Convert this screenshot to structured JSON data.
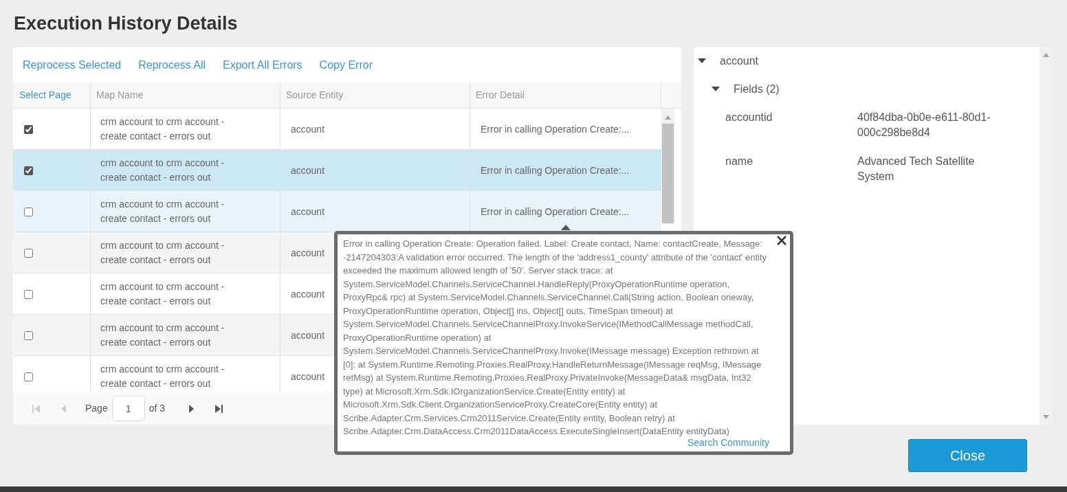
{
  "title": "Execution History Details",
  "toolbar": [
    "Reprocess Selected",
    "Reprocess All",
    "Export All Errors",
    "Copy Error"
  ],
  "table": {
    "select_page": "Select Page",
    "columns": [
      "Map Name",
      "Source Entity",
      "Error Detail"
    ],
    "rows": [
      {
        "checked": true,
        "selected": false,
        "hovered": false,
        "map_name": "crm account to crm account - create contact - errors out",
        "source_entity": "account",
        "error_detail": "Error in calling Operation Create:..."
      },
      {
        "checked": true,
        "selected": true,
        "hovered": false,
        "map_name": "crm account to crm account - create contact - errors out",
        "source_entity": "account",
        "error_detail": "Error in calling Operation Create:..."
      },
      {
        "checked": false,
        "selected": false,
        "hovered": true,
        "map_name": "crm account to crm account - create contact - errors out",
        "source_entity": "account",
        "error_detail": "Error in calling Operation Create:..."
      },
      {
        "checked": false,
        "selected": false,
        "hovered": false,
        "map_name": "crm account to crm account - create contact - errors out",
        "source_entity": "account"
      },
      {
        "checked": false,
        "selected": false,
        "hovered": false,
        "map_name": "crm account to crm account - create contact - errors out",
        "source_entity": "account"
      },
      {
        "checked": false,
        "selected": false,
        "hovered": false,
        "map_name": "crm account to crm account - create contact - errors out",
        "source_entity": "account"
      },
      {
        "checked": false,
        "selected": false,
        "hovered": false,
        "map_name": "crm account to crm account - create contact - errors out",
        "source_entity": "account"
      }
    ]
  },
  "pager": {
    "label": "Page",
    "value": "1",
    "of": "of 3",
    "buttons": [
      {
        "kind": "first",
        "disabled": true
      },
      {
        "kind": "prev",
        "disabled": true
      },
      {
        "kind": "next",
        "disabled": false
      },
      {
        "kind": "last",
        "disabled": false
      }
    ]
  },
  "tree": {
    "label": "account",
    "expanded": true,
    "children": [
      {
        "label": "Fields (2)",
        "expanded": true,
        "fields": [
          {
            "name": "accountid",
            "value": "40f84dba-0b0e-e611-80d1-000c298be8d4"
          },
          {
            "name": "name",
            "value": "Advanced Tech Satellite System"
          }
        ]
      }
    ]
  },
  "popover": {
    "text": "Error in calling Operation Create: Operation failed. Label: Create contact, Name: contactCreate, Message: -2147204303:A validation error occurred. The length of the 'address1_county' attribute of the 'contact' entity exceeded the maximum allowed length of '50'. Server stack trace: at System.ServiceModel.Channels.ServiceChannel.HandleReply(ProxyOperationRuntime operation, ProxyRpc& rpc) at System.ServiceModel.Channels.ServiceChannel.Call(String action, Boolean oneway, ProxyOperationRuntime operation, Object[] ins, Object[] outs, TimeSpan timeout) at System.ServiceModel.Channels.ServiceChannelProxy.InvokeService(IMethodCallMessage methodCall, ProxyOperationRuntime operation) at System.ServiceModel.Channels.ServiceChannelProxy.Invoke(IMessage message) Exception rethrown at [0]: at System.Runtime.Remoting.Proxies.RealProxy.HandleReturnMessage(IMessage reqMsg, IMessage retMsg) at System.Runtime.Remoting.Proxies.RealProxy.PrivateInvoke(MessageData& msgData, Int32 type) at Microsoft.Xrm.Sdk.IOrganizationService.Create(Entity entity) at Microsoft.Xrm.Sdk.Client.OrganizationServiceProxy.CreateCore(Entity entity) at Scribe.Adapter.Crm.Services.Crm2011Service.Create(Entity entity, Boolean retry) at Scribe.Adapter.Crm.DataAccess.Crm2011DataAccess.ExecuteSingleInsert(DataEntity entityData)",
    "link": "Search Community"
  },
  "close_button": "Close"
}
